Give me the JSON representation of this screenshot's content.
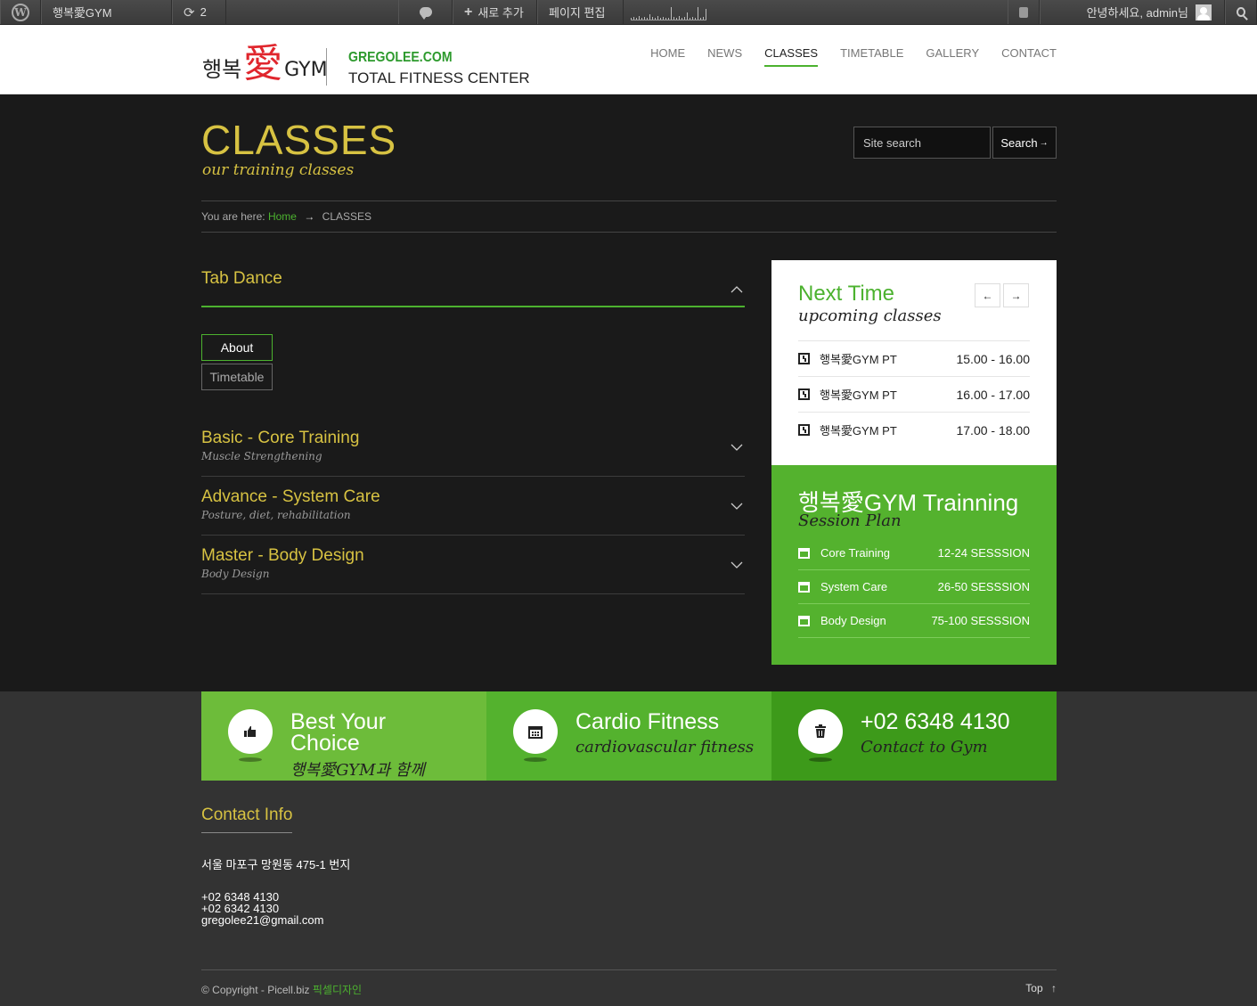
{
  "adminbar": {
    "site_name": "행복愛GYM",
    "updates_count": "2",
    "new_label": "새로 추가",
    "edit_label": "페이지 편집",
    "greeting": "안녕하세요, admin님"
  },
  "header": {
    "logo_korean": "행복",
    "logo_love": "愛",
    "logo_gym": "GYM",
    "site_url": "GREGOLEE.COM",
    "tagline": "TOTAL FITNESS CENTER"
  },
  "nav": {
    "items": [
      "HOME",
      "NEWS",
      "CLASSES",
      "TIMETABLE",
      "GALLERY",
      "CONTACT"
    ],
    "active": "CLASSES"
  },
  "page": {
    "title": "CLASSES",
    "subtitle": "our training classes",
    "search_placeholder": "Site search",
    "search_button": "Search",
    "search_arrow": "→"
  },
  "breadcrumb": {
    "prefix": "You are here:",
    "home": "Home",
    "arrow": "→",
    "current": "CLASSES"
  },
  "accordion": {
    "open_item": {
      "title": "Tab Dance",
      "tabs": [
        "About",
        "Timetable"
      ],
      "active_tab": "About"
    },
    "items": [
      {
        "title": "Basic - Core Training",
        "subtitle": "Muscle Strengthening"
      },
      {
        "title": "Advance - System Care",
        "subtitle": "Posture, diet, rehabilitation"
      },
      {
        "title": "Master - Body Design",
        "subtitle": "Body Design"
      }
    ]
  },
  "next_time": {
    "title": "Next Time",
    "subtitle": "upcoming classes",
    "prev_glyph": "←",
    "next_glyph": "→",
    "rows": [
      {
        "name": "행복愛GYM PT",
        "time": "15.00 - 16.00"
      },
      {
        "name": "행복愛GYM PT",
        "time": "16.00 - 17.00"
      },
      {
        "name": "행복愛GYM PT",
        "time": "17.00 - 18.00"
      }
    ]
  },
  "session_plan": {
    "title": "행복愛GYM Trainning",
    "subtitle": "Session Plan",
    "rows": [
      {
        "name": "Core Training",
        "value": "12-24 SESSSION"
      },
      {
        "name": "System Care",
        "value": "26-50 SESSSION"
      },
      {
        "name": "Body Design",
        "value": "75-100 SESSSION"
      }
    ]
  },
  "features": [
    {
      "title": "Best Your Choice",
      "subtitle": "행복愛GYM과 함께",
      "icon": "thumbs-up-icon",
      "color": "#6dbc3a"
    },
    {
      "title": "Cardio Fitness",
      "subtitle": "cardiovascular fitness",
      "icon": "calendar-icon",
      "color": "#54b22e"
    },
    {
      "title": "+02 6348 4130",
      "subtitle": "Contact to Gym",
      "icon": "trash-icon",
      "color": "#3d9a1a"
    }
  ],
  "contact": {
    "title": "Contact Info",
    "address": "서울 마포구 망원동 475-1 번지",
    "phone1": "+02 6348 4130",
    "phone2": "+02 6342 4130",
    "email": "gregolee21@gmail.com"
  },
  "footer": {
    "copyright": "© Copyright - Picell.biz",
    "credit": "픽셀디자인",
    "top": "Top",
    "top_arrow": "↑"
  },
  "colors": {
    "accent_green": "#4cb22f",
    "gold": "#d7c242",
    "logo_red": "#e0262d"
  }
}
